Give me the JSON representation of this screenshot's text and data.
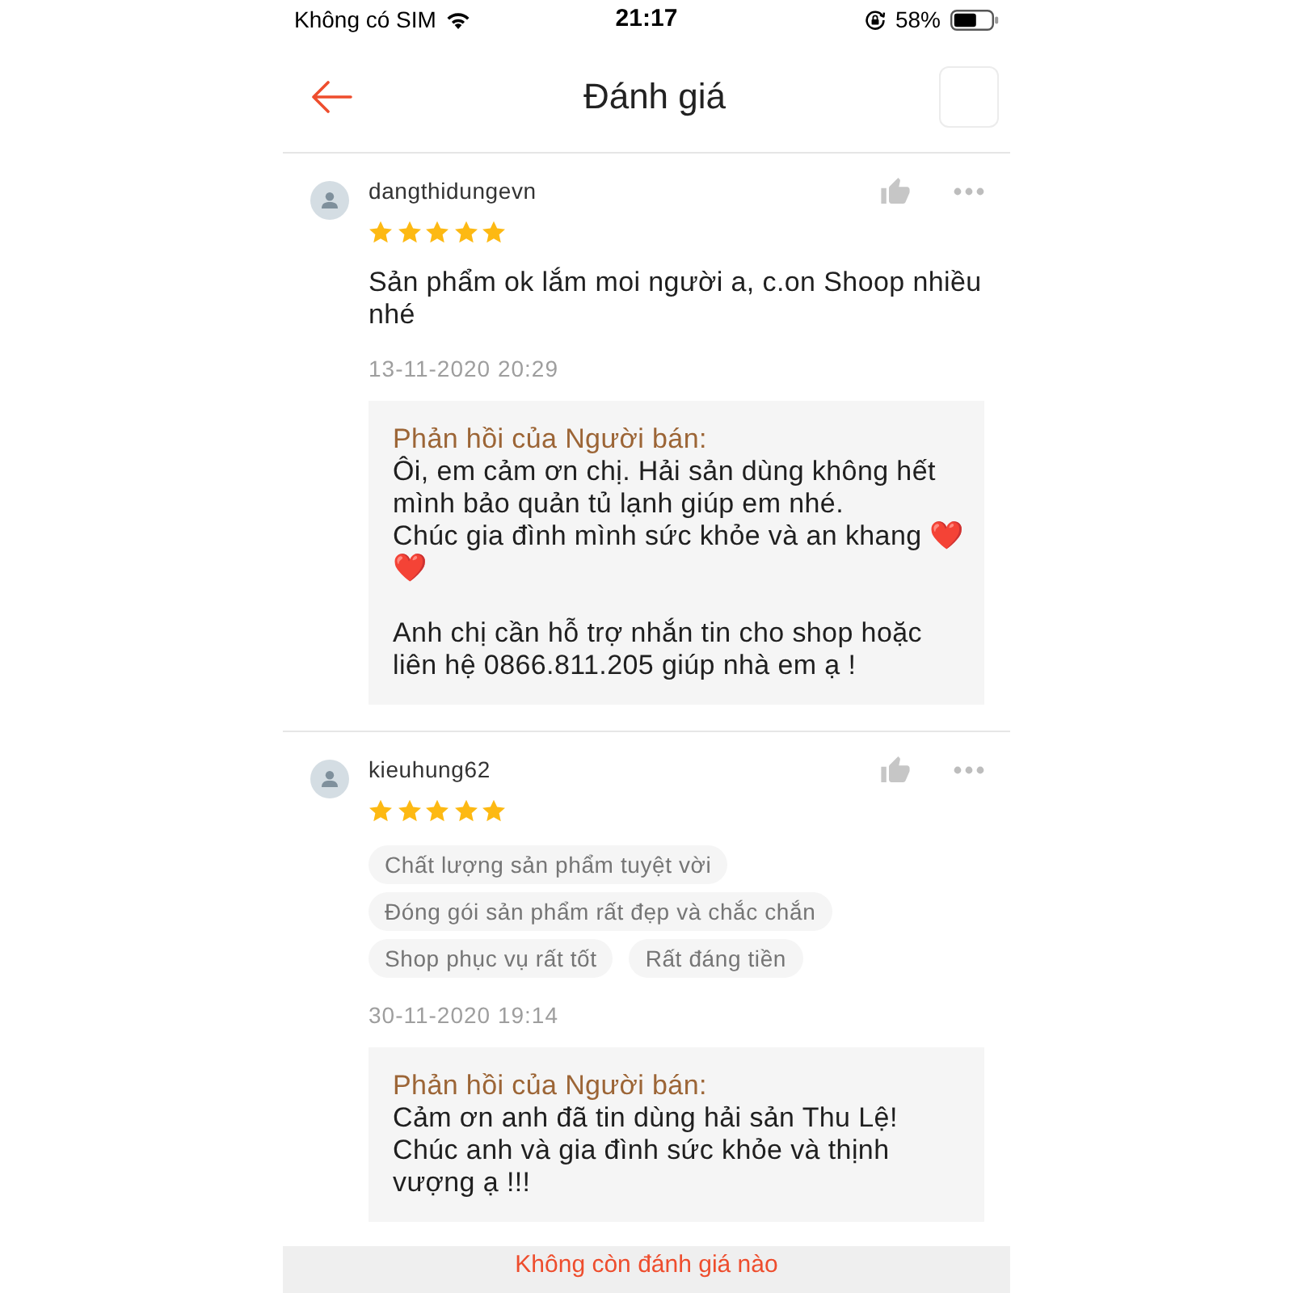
{
  "status_bar": {
    "carrier": "Không có SIM",
    "time": "21:17",
    "battery": "58%"
  },
  "header": {
    "title": "Đánh giá"
  },
  "reviews": [
    {
      "username": "dangthidungevn",
      "stars": 5,
      "comment": "Sản phẩm ok lắm moi người a, c.on Shoop nhiều nhé",
      "date": "13-11-2020 20:29",
      "reply": {
        "label": "Phản hồi của Người bán:",
        "message": [
          {
            "kind": "text",
            "text": "Ôi, em cảm ơn chị. Hải sản dùng không hết mình bảo quản tủ lạnh giúp em nhé.\nChúc gia đình mình sức khỏe và an khang "
          },
          {
            "kind": "emoji",
            "text": "❤️"
          },
          {
            "kind": "emoji",
            "text": "❤️"
          },
          {
            "kind": "text",
            "text": "\n\nAnh chị cần hỗ trợ nhắn tin cho shop hoặc liên hệ 0866.811.205 giúp nhà em ạ !"
          }
        ]
      }
    },
    {
      "username": "kieuhung62",
      "stars": 5,
      "tags": [
        "Chất lượng sản phẩm tuyệt vời",
        "Đóng gói sản phẩm rất đẹp và chắc chắn",
        "Shop phục vụ rất tốt",
        "Rất đáng tiền"
      ],
      "date": "30-11-2020 19:14",
      "reply": {
        "label": "Phản hồi của Người bán:",
        "message": [
          {
            "kind": "text",
            "text": "Cảm ơn anh đã tin dùng hải sản Thu Lệ!\nChúc anh và gia đình sức khỏe và thịnh vượng ạ !!!"
          }
        ]
      }
    }
  ],
  "footer": {
    "text": "Không còn đánh giá nào"
  }
}
